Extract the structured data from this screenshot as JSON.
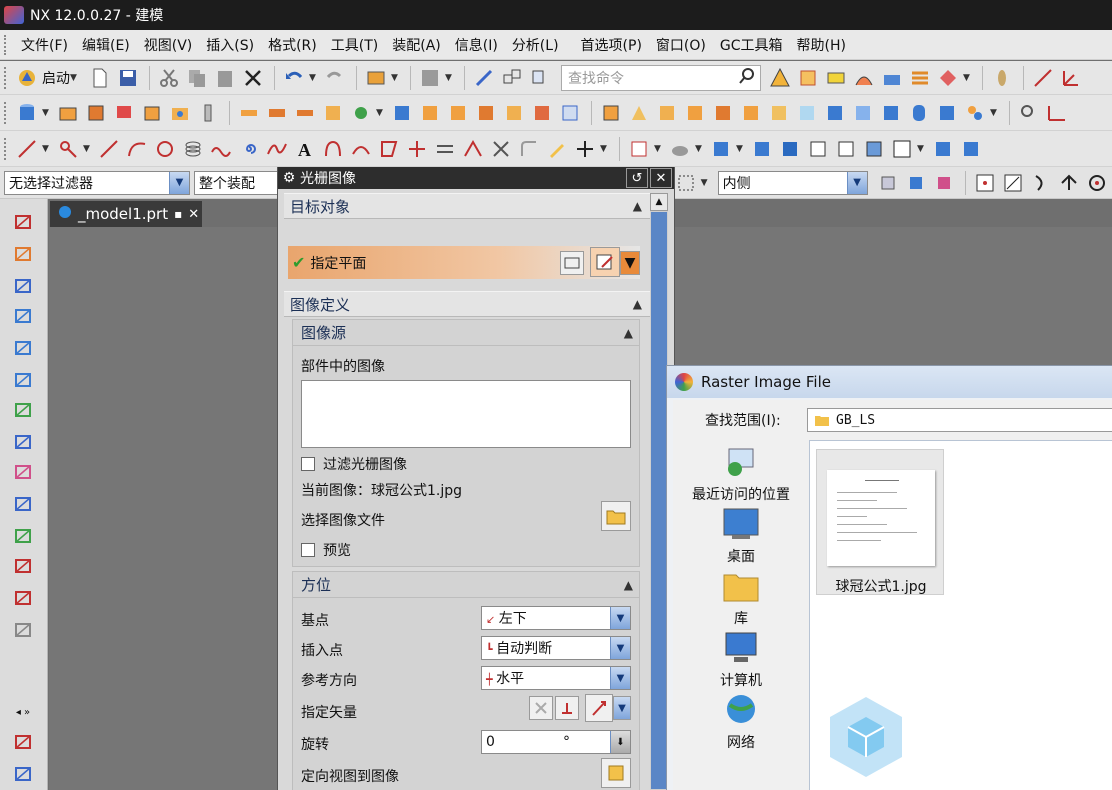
{
  "app": {
    "title": "NX 12.0.0.27 - 建模"
  },
  "menu": [
    "文件(F)",
    "编辑(E)",
    "视图(V)",
    "插入(S)",
    "格式(R)",
    "工具(T)",
    "装配(A)",
    "信息(I)",
    "分析(L)",
    "首选项(P)",
    "窗口(O)",
    "GC工具箱",
    "帮助(H)"
  ],
  "toolbar": {
    "start_label": "启动",
    "search_placeholder": "查找命令"
  },
  "selection_bar": {
    "filter": "无选择过滤器",
    "scope": "整个装配",
    "snap_mode": "内侧"
  },
  "document_tab": {
    "label": "_model1.prt"
  },
  "raster_dialog": {
    "title": "光栅图像",
    "target_section": "目标对象",
    "specify_plane": "指定平面",
    "image_def_section": "图像定义",
    "image_source_section": "图像源",
    "images_in_part_label": "部件中的图像",
    "filter_raster_label": "过滤光栅图像",
    "current_image_label": "当前图像：球冠公式1.jpg",
    "select_image_file_label": "选择图像文件",
    "preview_label": "预览",
    "orientation_section": "方位",
    "base_point_label": "基点",
    "base_point_value": "左下",
    "insert_point_label": "插入点",
    "insert_point_value": "自动判断",
    "ref_direction_label": "参考方向",
    "ref_direction_value": "水平",
    "specify_vector_label": "指定矢量",
    "rotation_label": "旋转",
    "rotation_value": "0",
    "rotation_unit": "°",
    "orient_view_label": "定向视图到图像"
  },
  "file_dialog": {
    "title": "Raster Image File",
    "look_in_label": "查找范围(I):",
    "look_in_value": "GB_LS",
    "places": [
      "最近访问的位置",
      "桌面",
      "库",
      "计算机",
      "网络"
    ],
    "files": [
      {
        "name": "球冠公式1.jpg"
      }
    ]
  }
}
